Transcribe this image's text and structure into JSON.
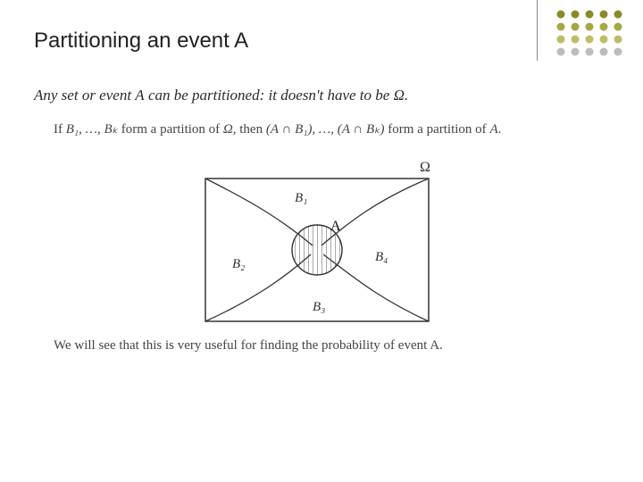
{
  "title": "Partitioning an event A",
  "line1_full": "Any set or event A can be partitioned: it doesn't have to be Ω.",
  "line1_a": "Any set or event ",
  "line1_b": " can be partitioned: it doesn't have to be ",
  "line1_c": ".",
  "A": "A",
  "Omega": "Ω",
  "line2_full": "If B₁, …, Bₖ form a partition of Ω, then (A ∩ B₁), …, (A ∩ Bₖ) form a partition of A.",
  "line2_a": "If ",
  "line2_b": " form a partition of ",
  "line2_c": ", then ",
  "line2_d": " form a partition of ",
  "line2_e": ".",
  "B_seq": "B₁, …, Bₖ",
  "AB_seq": "(A ∩ B₁), …, (A ∩ Bₖ)",
  "line3": "We will see that this is very useful for finding the probability of event A.",
  "diagram": {
    "Omega": "Ω",
    "A": "A",
    "B1": "B₁",
    "B2": "B₂",
    "B3": "B₃",
    "B4": "B₄"
  }
}
